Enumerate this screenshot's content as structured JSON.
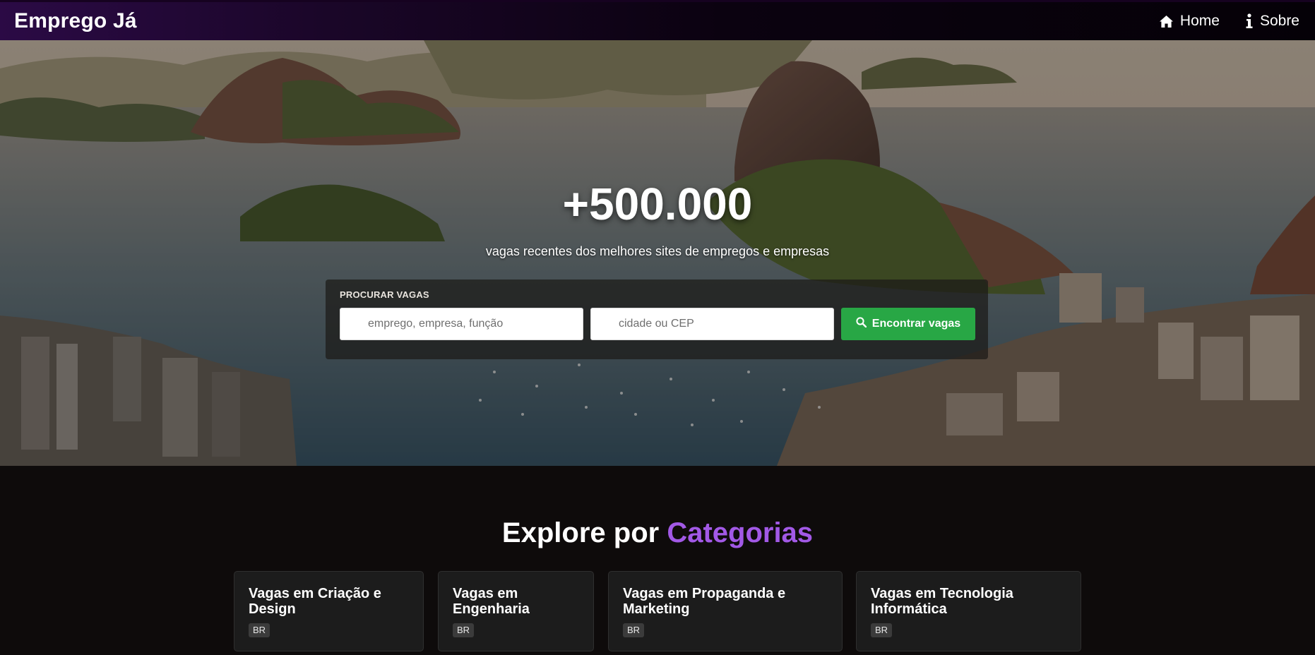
{
  "navbar": {
    "brand": "Emprego Já",
    "links": [
      {
        "label": "Home",
        "icon": "home-icon"
      },
      {
        "label": "Sobre",
        "icon": "info-icon"
      }
    ]
  },
  "hero": {
    "stat": "+500.000",
    "subtitle": "vagas recentes dos melhores sites de empregos e empresas",
    "search": {
      "label": "PROCURAR VAGAS",
      "what_placeholder": "emprego, empresa, função",
      "where_placeholder": "cidade ou CEP",
      "button_label": "Encontrar vagas",
      "button_icon": "search-icon"
    }
  },
  "categories": {
    "title_prefix": "Explore por ",
    "title_accent": "Categorias",
    "accent_color": "#a259e6",
    "items": [
      {
        "title": "Vagas em Criação e Design",
        "badge": "BR"
      },
      {
        "title": "Vagas em Engenharia",
        "badge": "BR"
      },
      {
        "title": "Vagas em Propaganda e Marketing",
        "badge": "BR"
      },
      {
        "title": "Vagas em Tecnologia Informática",
        "badge": "BR"
      }
    ]
  },
  "colors": {
    "primary_button": "#28a745",
    "navbar_gradient_start": "#2b0a45",
    "page_background": "#0e0b0b"
  }
}
